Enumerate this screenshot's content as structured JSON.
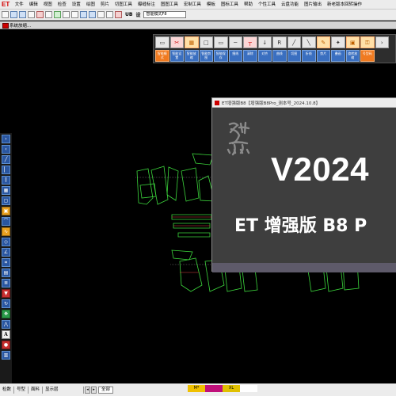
{
  "menubar": {
    "logo": "ET",
    "items": [
      "文件",
      "编辑",
      "视图",
      "检查",
      "设置",
      "绘图",
      "剪片",
      "切图工具",
      "曝缝标注",
      "图图工具",
      "宏制工具",
      "模板",
      "图标工具",
      "帮助",
      "个性工具",
      "云盘功能",
      "图片输出",
      "新老版本回转操作"
    ]
  },
  "toolbar": {
    "text_ub": "UB",
    "text_set": "设",
    "mode_select": "智能模式F8"
  },
  "layerbar": {
    "label": "系统放缩..."
  },
  "left_tools": {
    "letter": "A"
  },
  "palette": {
    "row1_icons": [
      "file-icon",
      "scissors-icon",
      "palette-icon",
      "rect-icon",
      "rect-icon",
      "line-icon",
      "tline-icon",
      "arrow-icon",
      "r-icon",
      "slash-icon",
      "cross-icon",
      "pen-icon",
      "star-icon",
      "bag-icon",
      "key-icon"
    ],
    "row2_labels": [
      "智能模式",
      "智能设置",
      "智能放缩",
      "智能剪图",
      "智能保存",
      "细线",
      "清除",
      "对齐",
      "曲线",
      "切图",
      "折线",
      "剪片",
      "叠画",
      "旋转放缩",
      "号型码"
    ]
  },
  "dialog": {
    "title": "ET增强版B8【增强版B8Pro_测本号_2024.10.8】",
    "version": "V2024",
    "subtitle": "ET 增强版 B8 P"
  },
  "statusbar": {
    "tabs": [
      "检数",
      "号型",
      "面料",
      "显示层"
    ],
    "field_value": "",
    "all_label": "全部",
    "sizes": [
      {
        "label": "M*",
        "color": "#f0c000"
      },
      {
        "label": "",
        "color": "#c0107a"
      },
      {
        "label": "XL",
        "color": "#e0c000"
      },
      {
        "label": "",
        "color": "#ffffff"
      }
    ]
  }
}
